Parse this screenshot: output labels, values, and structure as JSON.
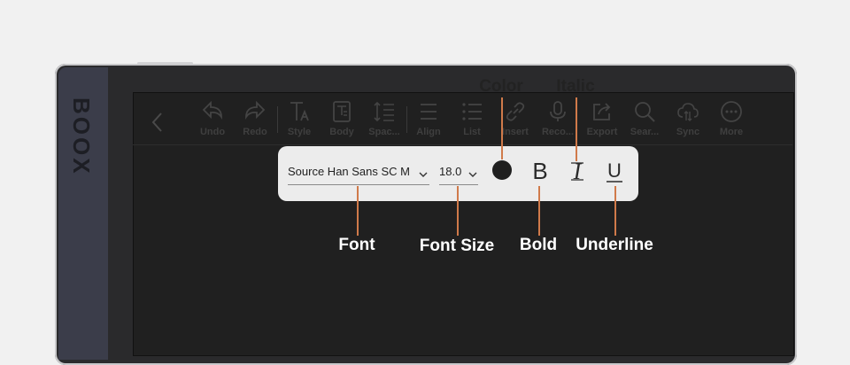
{
  "device": {
    "brand": "BOOX"
  },
  "toolbar": {
    "tools": [
      {
        "label": "Undo",
        "icon": "undo-icon"
      },
      {
        "label": "Redo",
        "icon": "redo-icon"
      },
      {
        "label": "Style",
        "icon": "text-style-icon"
      },
      {
        "label": "Body",
        "icon": "body-text-icon"
      },
      {
        "label": "Spac...",
        "icon": "line-spacing-icon"
      },
      {
        "label": "Align",
        "icon": "align-icon"
      },
      {
        "label": "List",
        "icon": "list-icon"
      },
      {
        "label": "Insert",
        "icon": "link-icon"
      },
      {
        "label": "Reco...",
        "icon": "microphone-icon"
      },
      {
        "label": "Export",
        "icon": "export-icon"
      },
      {
        "label": "Sear...",
        "icon": "search-icon"
      },
      {
        "label": "Sync",
        "icon": "cloud-sync-icon"
      },
      {
        "label": "More",
        "icon": "more-icon"
      }
    ]
  },
  "format_popup": {
    "font": "Source Han Sans SC M",
    "font_size": "18.0",
    "color": "#1f1f1f",
    "bold_glyph": "B",
    "italic_glyph": "I",
    "underline_glyph": "U"
  },
  "callouts": {
    "color": "Color",
    "italic": "Italic",
    "font": "Font",
    "font_size": "Font Size",
    "bold": "Bold",
    "underline": "Underline"
  }
}
